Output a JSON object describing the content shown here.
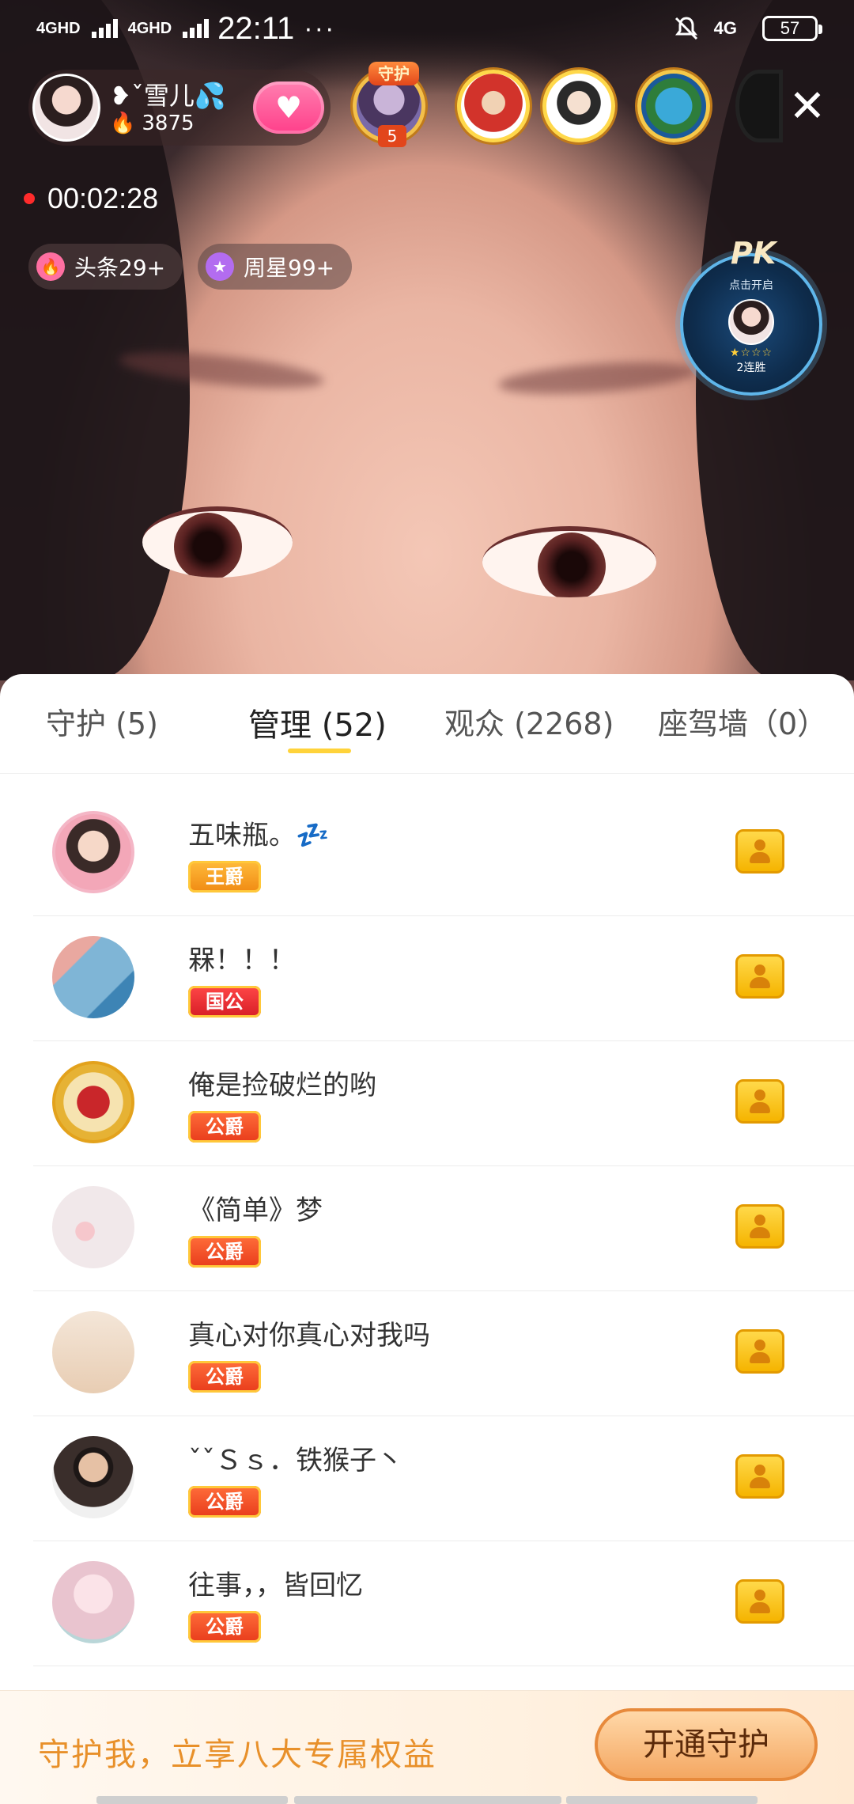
{
  "status_bar": {
    "signal_1": "4GHD",
    "signal_2": "4GHD",
    "time": "22:11",
    "dots": "···",
    "network_right": "4G",
    "battery": "57"
  },
  "host": {
    "name": "❥ˇ雪儿💦",
    "heat": "3875"
  },
  "guard_badge": "守护",
  "guard_count": "5",
  "live_timer": "00:02:28",
  "tags": [
    {
      "label": "头条29+",
      "color": "#ff6fa1"
    },
    {
      "label": "周星99+",
      "color": "#b36cf0"
    }
  ],
  "pk": {
    "logo": "PK",
    "hint": "点击开启",
    "stars": "★☆☆☆",
    "streak": "2连胜"
  },
  "tabs": [
    {
      "label": "守护 (5)"
    },
    {
      "label": "管理 (52)"
    },
    {
      "label": "观众 (2268)"
    },
    {
      "label": "座驾墙（0）"
    }
  ],
  "list": [
    {
      "name": "五味瓶。💤",
      "rank": "王爵",
      "avatar_color": "#f3a7b8"
    },
    {
      "name": "槑！！！",
      "rank": "国公",
      "avatar_color": "#7fb5d6"
    },
    {
      "name": "俺是捡破烂的哟",
      "rank": "公爵",
      "avatar_color": "#c9262a"
    },
    {
      "name": "《简单》梦",
      "rank": "公爵",
      "avatar_color": "#f1e8ea"
    },
    {
      "name": "真心对你真心对我吗",
      "rank": "公爵",
      "avatar_color": "#f0ddc9"
    },
    {
      "name": "ˇˇＳｓ．铁猴子丶",
      "rank": "公爵",
      "avatar_color": "#3a2e2b"
    },
    {
      "name": "往事，，皆回忆",
      "rank": "公爵",
      "avatar_color": "#e9c4cf"
    }
  ],
  "promo": {
    "text": "守护我，立享八大专属权益",
    "button": "开通守护"
  }
}
